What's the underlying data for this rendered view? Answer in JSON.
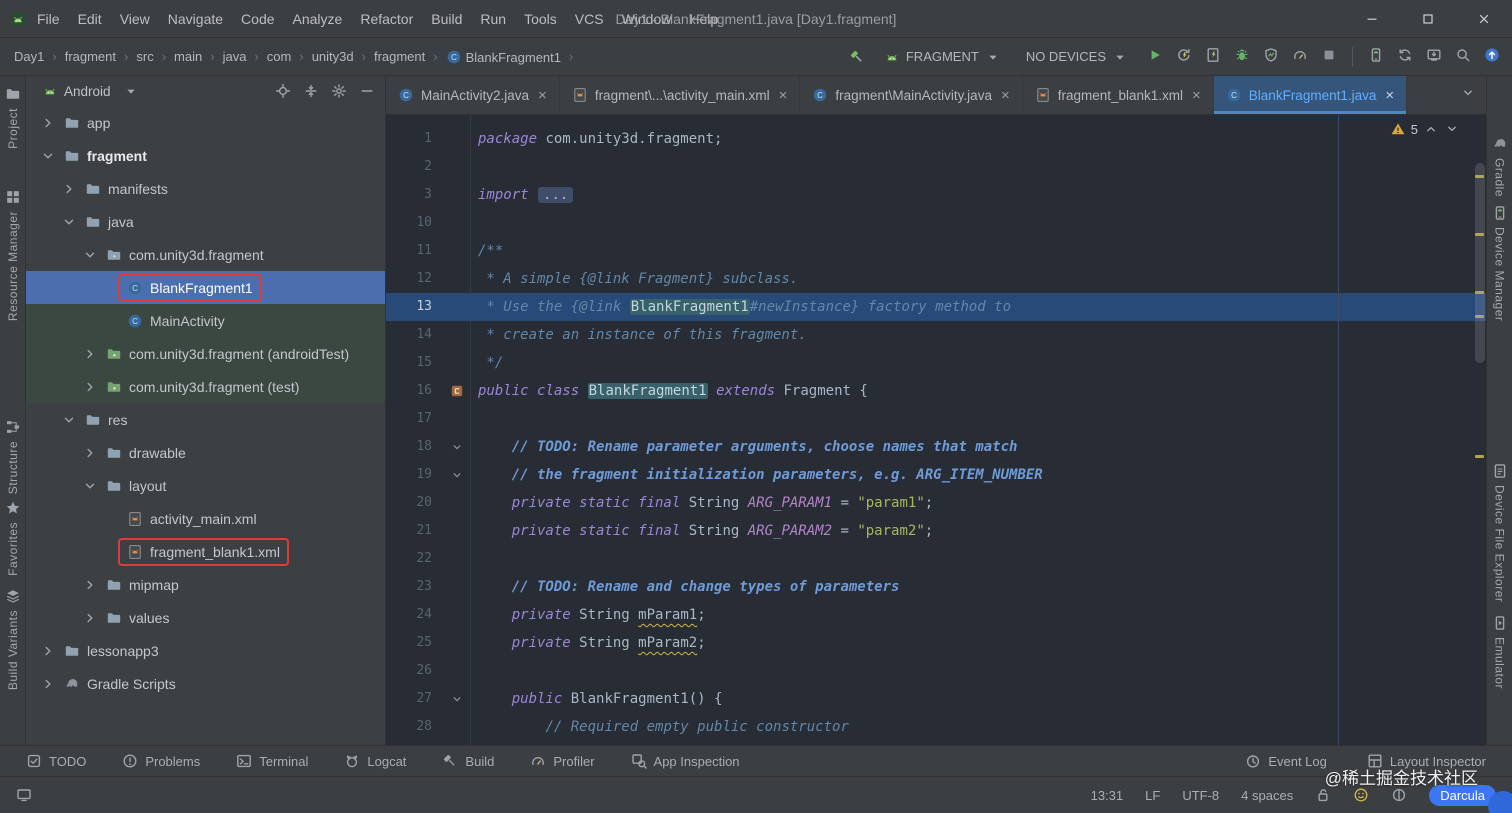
{
  "window": {
    "title": "Day1 - BlankFragment1.java [Day1.fragment]"
  },
  "menu": {
    "items": [
      "File",
      "Edit",
      "View",
      "Navigate",
      "Code",
      "Analyze",
      "Refactor",
      "Build",
      "Run",
      "Tools",
      "VCS",
      "Window",
      "Help"
    ]
  },
  "toolbar": {
    "breadcrumbs": [
      "Day1",
      "fragment",
      "src",
      "main",
      "java",
      "com",
      "unity3d",
      "fragment",
      "BlankFragment1"
    ],
    "separator": "›",
    "run_config": "FRAGMENT",
    "devices": "NO DEVICES",
    "actions": [
      {
        "name": "run",
        "icon": "play"
      },
      {
        "name": "apply-changes",
        "icon": "apply-changes"
      },
      {
        "name": "apply-code-changes",
        "icon": "code-changes"
      },
      {
        "name": "debug",
        "icon": "bug"
      },
      {
        "name": "profile-app",
        "icon": "shield"
      },
      {
        "name": "profiler",
        "icon": "gauge"
      },
      {
        "name": "stop",
        "icon": "stop"
      },
      {
        "name": "device-manager",
        "icon": "device-phone"
      },
      {
        "name": "sync-project",
        "icon": "sync"
      },
      {
        "name": "sdk-manager",
        "icon": "sdk"
      },
      {
        "name": "search-everywhere",
        "icon": "search"
      },
      {
        "name": "ide-update",
        "icon": "update"
      }
    ]
  },
  "tabs": {
    "close_glyph": "×",
    "items": [
      {
        "label": "MainActivity2.java",
        "icon": "class"
      },
      {
        "label": "fragment\\...\\activity_main.xml",
        "icon": "xml"
      },
      {
        "label": "fragment\\MainActivity.java",
        "icon": "class"
      },
      {
        "label": "fragment_blank1.xml",
        "icon": "xml"
      },
      {
        "label": "BlankFragment1.java",
        "icon": "class",
        "active": true
      }
    ]
  },
  "project": {
    "header": "Android",
    "tree": [
      {
        "label": "app",
        "depth": 0,
        "chevron": "right",
        "icon": "folder"
      },
      {
        "label": "fragment",
        "depth": 0,
        "chevron": "down",
        "icon": "folder",
        "bold": true
      },
      {
        "label": "manifests",
        "depth": 1,
        "chevron": "right",
        "icon": "folder"
      },
      {
        "label": "java",
        "depth": 1,
        "chevron": "down",
        "icon": "folder"
      },
      {
        "label": "com.unity3d.fragment",
        "depth": 2,
        "chevron": "down",
        "icon": "package"
      },
      {
        "label": "BlankFragment1",
        "depth": 3,
        "icon": "class",
        "selected": true,
        "annotated": true
      },
      {
        "label": "MainActivity",
        "depth": 3,
        "icon": "class",
        "tinted": true
      },
      {
        "label": "com.unity3d.fragment (androidTest)",
        "depth": 2,
        "chevron": "right",
        "icon": "package-green",
        "tinted": true
      },
      {
        "label": "com.unity3d.fragment (test)",
        "depth": 2,
        "chevron": "right",
        "icon": "package-green",
        "tinted": true
      },
      {
        "label": "res",
        "depth": 1,
        "chevron": "down",
        "icon": "folder"
      },
      {
        "label": "drawable",
        "depth": 2,
        "chevron": "right",
        "icon": "folder"
      },
      {
        "label": "layout",
        "depth": 2,
        "chevron": "down",
        "icon": "folder"
      },
      {
        "label": "activity_main.xml",
        "depth": 3,
        "icon": "xml"
      },
      {
        "label": "fragment_blank1.xml",
        "depth": 3,
        "icon": "xml",
        "annotated": true
      },
      {
        "label": "mipmap",
        "depth": 2,
        "chevron": "right",
        "icon": "folder"
      },
      {
        "label": "values",
        "depth": 2,
        "chevron": "right",
        "icon": "folder"
      },
      {
        "label": "lessonapp3",
        "depth": 0,
        "chevron": "right",
        "icon": "folder"
      },
      {
        "label": "Gradle Scripts",
        "depth": 0,
        "chevron": "right",
        "icon": "gradle"
      }
    ]
  },
  "editor": {
    "warning_count": "5",
    "lines": [
      {
        "n": "1",
        "segs": [
          [
            "kw",
            "package"
          ],
          [
            "pl",
            " com.unity3d.fragment;"
          ]
        ]
      },
      {
        "n": "2",
        "segs": []
      },
      {
        "n": "3",
        "segs": [
          [
            "kw",
            "import"
          ],
          [
            "pl",
            " "
          ],
          [
            "fold",
            "..."
          ]
        ]
      },
      {
        "n": "10",
        "segs": []
      },
      {
        "n": "11",
        "segs": [
          [
            "doc",
            "/**"
          ]
        ]
      },
      {
        "n": "12",
        "segs": [
          [
            "doc",
            " * A simple {@link Fragment} subclass."
          ]
        ]
      },
      {
        "n": "13",
        "hl": true,
        "segs": [
          [
            "doc",
            " * Use the {@link "
          ],
          [
            "dochl",
            "BlankFragment1"
          ],
          [
            "doc",
            "#newInstance} factory method to"
          ]
        ]
      },
      {
        "n": "14",
        "segs": [
          [
            "doc",
            " * create an instance of this fragment."
          ]
        ]
      },
      {
        "n": "15",
        "segs": [
          [
            "doc",
            " */"
          ]
        ]
      },
      {
        "n": "16",
        "gutter": "class-marker",
        "segs": [
          [
            "kw",
            "public"
          ],
          [
            "pl",
            " "
          ],
          [
            "kw",
            "class"
          ],
          [
            "pl",
            " "
          ],
          [
            "clhl",
            "BlankFragment1"
          ],
          [
            "pl",
            " "
          ],
          [
            "kw",
            "extends"
          ],
          [
            "pl",
            " Fragment {"
          ]
        ]
      },
      {
        "n": "17",
        "segs": []
      },
      {
        "n": "18",
        "fold": true,
        "segs": [
          [
            "pl",
            "    "
          ],
          [
            "todo",
            "// TODO: Rename parameter arguments, choose names that match"
          ]
        ]
      },
      {
        "n": "19",
        "fold": true,
        "segs": [
          [
            "pl",
            "    "
          ],
          [
            "todo",
            "// the fragment initialization parameters, e.g. ARG_ITEM_NUMBER"
          ]
        ]
      },
      {
        "n": "20",
        "segs": [
          [
            "pl",
            "    "
          ],
          [
            "kw",
            "private static final"
          ],
          [
            "pl",
            " String "
          ],
          [
            "cst",
            "ARG_PARAM1"
          ],
          [
            "pl",
            " = "
          ],
          [
            "str",
            "\"param1\""
          ],
          [
            "pl",
            ";"
          ]
        ]
      },
      {
        "n": "21",
        "segs": [
          [
            "pl",
            "    "
          ],
          [
            "kw",
            "private static final"
          ],
          [
            "pl",
            " String "
          ],
          [
            "cst",
            "ARG_PARAM2"
          ],
          [
            "pl",
            " = "
          ],
          [
            "str",
            "\"param2\""
          ],
          [
            "pl",
            ";"
          ]
        ]
      },
      {
        "n": "22",
        "segs": []
      },
      {
        "n": "23",
        "segs": [
          [
            "pl",
            "    "
          ],
          [
            "todo",
            "// TODO: Rename and change types of parameters"
          ]
        ]
      },
      {
        "n": "24",
        "segs": [
          [
            "pl",
            "    "
          ],
          [
            "kw",
            "private"
          ],
          [
            "pl",
            " String "
          ],
          [
            "fld",
            "mParam1"
          ],
          [
            "pl",
            ";"
          ]
        ]
      },
      {
        "n": "25",
        "segs": [
          [
            "pl",
            "    "
          ],
          [
            "kw",
            "private"
          ],
          [
            "pl",
            " String "
          ],
          [
            "fld",
            "mParam2"
          ],
          [
            "pl",
            ";"
          ]
        ]
      },
      {
        "n": "26",
        "segs": []
      },
      {
        "n": "27",
        "fold": true,
        "segs": [
          [
            "pl",
            "    "
          ],
          [
            "kw",
            "public"
          ],
          [
            "pl",
            " BlankFragment1() {"
          ]
        ]
      },
      {
        "n": "28",
        "segs": [
          [
            "pl",
            "        "
          ],
          [
            "cmt",
            "// Required empty public constructor"
          ]
        ]
      }
    ]
  },
  "left_strip": {
    "items": [
      {
        "label": "Project",
        "icon": "project-folder"
      },
      {
        "label": "Resource Manager",
        "icon": "resource-manager"
      },
      {
        "label": "Structure",
        "icon": "structure"
      },
      {
        "label": "Favorites",
        "icon": "star"
      },
      {
        "label": "Build Variants",
        "icon": "build-variants"
      }
    ]
  },
  "right_strip": {
    "items": [
      {
        "label": "Gradle",
        "icon": "gradle"
      },
      {
        "label": "Device Manager",
        "icon": "device-phone"
      },
      {
        "label": "Device File Explorer",
        "icon": "device-file-explorer"
      },
      {
        "label": "Emulator",
        "icon": "emulator"
      }
    ]
  },
  "bottom_bar": {
    "left": [
      {
        "label": "TODO",
        "icon": "todo"
      },
      {
        "label": "Problems",
        "icon": "problems"
      },
      {
        "label": "Terminal",
        "icon": "terminal"
      },
      {
        "label": "Logcat",
        "icon": "logcat"
      },
      {
        "label": "Build",
        "icon": "build-hammer-grey"
      },
      {
        "label": "Profiler",
        "icon": "gauge"
      },
      {
        "label": "App Inspection",
        "icon": "app-inspection"
      }
    ],
    "right": [
      {
        "label": "Event Log",
        "icon": "event-log"
      },
      {
        "label": "Layout Inspector",
        "icon": "layout-inspector"
      }
    ]
  },
  "status_bar": {
    "time": "13:31",
    "line_ending": "LF",
    "encoding": "UTF-8",
    "indent": "4 spaces",
    "theme": "Darcula"
  },
  "watermark": "@稀土掘金技术社区",
  "colors": {
    "selection_blue": "#4b6eaf",
    "annotation_red": "#e03a3a",
    "editor_bg": "#282c34",
    "panel_bg": "#3d4043",
    "active_tab_text": "#62aeff",
    "keyword": "#9a86d8",
    "string": "#a5b85e",
    "comment_doc": "#6287a8",
    "comment_todo": "#6f9bd8",
    "constant": "#b285c9",
    "line_highlight": "#274a78"
  }
}
